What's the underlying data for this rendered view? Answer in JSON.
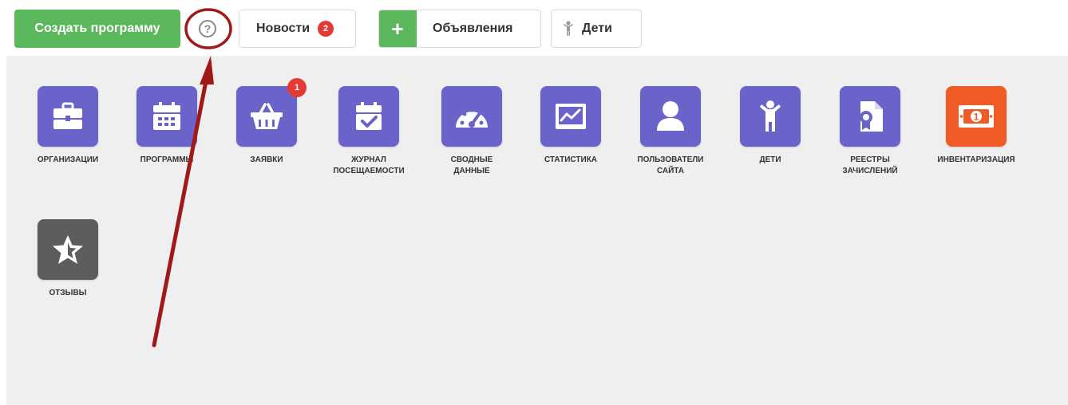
{
  "toolbar": {
    "create_label": "Создать программу",
    "help_glyph": "?",
    "news_label": "Новости",
    "news_count": "2",
    "ads_plus": "+",
    "ads_label": "Объявления",
    "kids_label": "Дети"
  },
  "tiles": [
    {
      "label": "Организации",
      "icon": "briefcase-icon",
      "color": "#6a63c9"
    },
    {
      "label": "Программы",
      "icon": "calendar-icon",
      "color": "#6a63c9"
    },
    {
      "label": "Заявки",
      "icon": "basket-icon",
      "color": "#6a63c9",
      "badge": "1"
    },
    {
      "label": "Журнал\nпосещаемости",
      "icon": "calendar-check-icon",
      "color": "#6a63c9"
    },
    {
      "label": "Сводные\nданные",
      "icon": "gauge-icon",
      "color": "#6a63c9"
    },
    {
      "label": "Статистика",
      "icon": "line-chart-icon",
      "color": "#6a63c9"
    },
    {
      "label": "Пользователи\nсайта",
      "icon": "user-icon",
      "color": "#6a63c9"
    },
    {
      "label": "Дети",
      "icon": "child-icon",
      "color": "#6a63c9"
    },
    {
      "label": "Реестры\nзачислений",
      "icon": "certificate-icon",
      "color": "#6a63c9"
    },
    {
      "label": "Инвентаризация",
      "icon": "money-bill-icon",
      "color": "#f05a24",
      "bill_digit": "1"
    },
    {
      "label": "Отзывы",
      "icon": "star-icon",
      "color": "#5d5d5d"
    }
  ],
  "colors": {
    "green": "#5cb85c",
    "purple": "#6a63c9",
    "orange": "#f05a24",
    "gray": "#5d5d5d",
    "badge_red": "#e53935",
    "annotation_red": "#a01818",
    "panel_bg": "#efefef"
  }
}
